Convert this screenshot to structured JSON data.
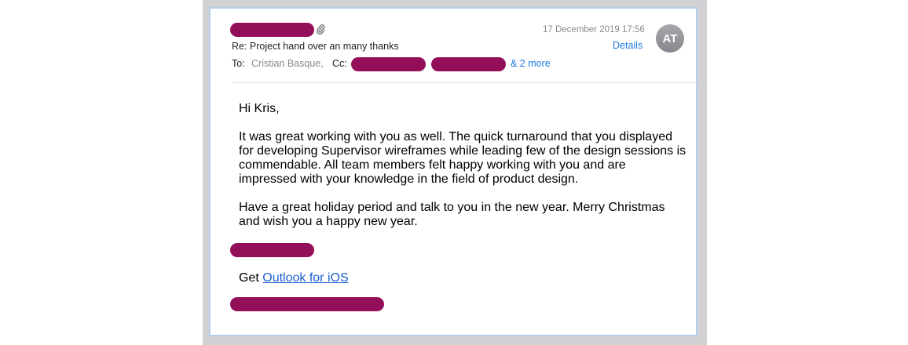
{
  "header": {
    "date": "17 December 2019 17:56",
    "subject": "Re: Project hand over an many thanks",
    "to_label": "To:",
    "to_value": "Cristian Basque,",
    "cc_label": "Cc:",
    "more_recipients": "& 2 more",
    "details_label": "Details",
    "avatar_initials": "AT",
    "attachment_icon": "paperclip-icon"
  },
  "body": {
    "greeting": "Hi Kris,",
    "paragraph_1": "It was great working with you as well. The quick turnaround that you displayed for developing Supervisor wireframes while leading few of the design sessions is commendable. All team members felt happy working with you and are impressed with your knowledge in the field of product design.",
    "paragraph_2": "Have a great holiday period and talk to you in the new year. Merry Christmas and wish you a happy new year.",
    "get_prefix": "Get",
    "outlook_link": "Outlook for iOS"
  },
  "colors": {
    "redaction": "#930f5a",
    "link": "#1f7ae0",
    "card_border": "#b3cdef"
  }
}
